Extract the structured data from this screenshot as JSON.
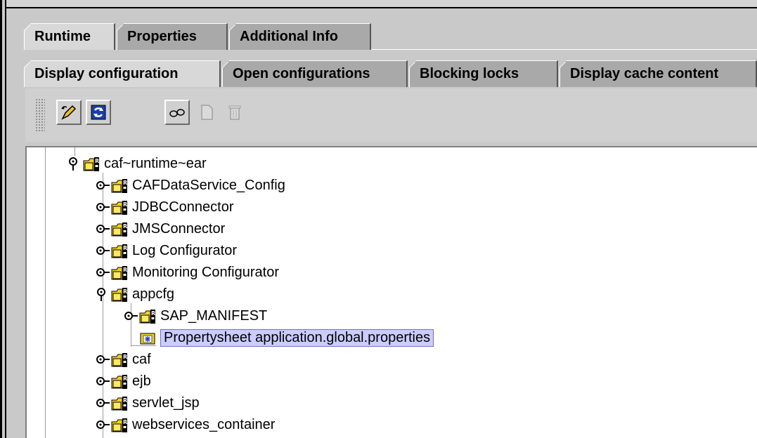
{
  "tabs_top": [
    "Runtime",
    "Properties",
    "Additional Info"
  ],
  "tabs_sub": [
    "Display configuration",
    "Open configurations",
    "Blocking locks",
    "Display cache content"
  ],
  "toolbar": {
    "buttons": [
      "edit-icon",
      "refresh-icon",
      "find-icon",
      "new-document-icon",
      "delete-icon"
    ]
  },
  "tree": {
    "nodes": [
      {
        "label": "caf~runtime~ear",
        "expanded": true
      },
      {
        "label": "CAFDataService_Config",
        "expanded": false
      },
      {
        "label": "JDBCConnector",
        "expanded": false
      },
      {
        "label": "JMSConnector",
        "expanded": false
      },
      {
        "label": "Log Configurator",
        "expanded": false
      },
      {
        "label": "Monitoring Configurator",
        "expanded": false
      },
      {
        "label": "appcfg",
        "expanded": true
      },
      {
        "label": "SAP_MANIFEST",
        "expanded": false
      },
      {
        "label": "Propertysheet application.global.properties",
        "selected": true
      },
      {
        "label": "caf",
        "expanded": false
      },
      {
        "label": "ejb",
        "expanded": false
      },
      {
        "label": "servlet_jsp",
        "expanded": false
      },
      {
        "label": "webservices_container",
        "expanded": false
      }
    ]
  },
  "colors": {
    "selection_bg": "#ccccff",
    "tab_active": "#d8d8d8",
    "tab_inactive": "#a9a9a9",
    "folder_yellow": "#f2d21a"
  }
}
